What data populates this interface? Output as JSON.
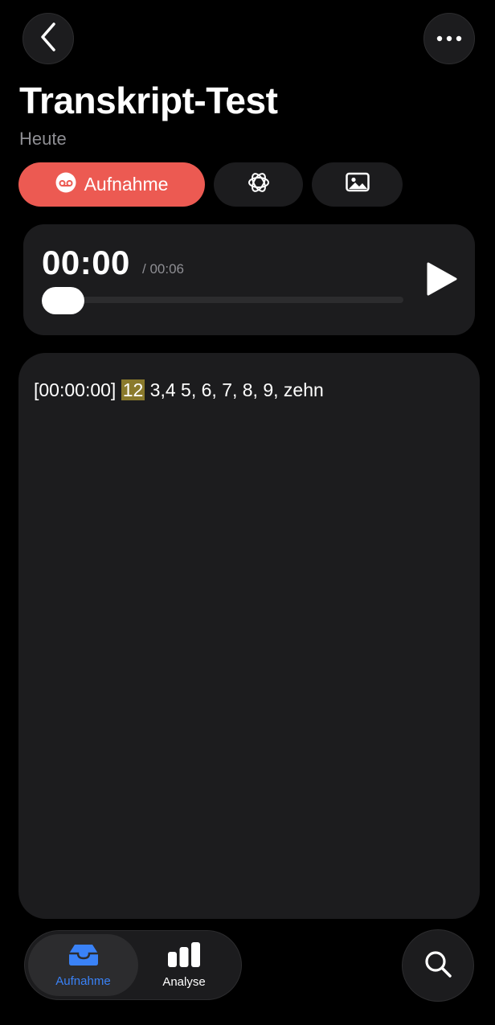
{
  "header": {
    "title": "Transkript-Test",
    "subtitle": "Heute",
    "back_icon": "chevron-left-icon",
    "more_icon": "ellipsis-icon"
  },
  "segments": [
    {
      "id": "recording",
      "label": "Aufnahme",
      "icon": "voicemail-icon",
      "selected": true
    },
    {
      "id": "ai",
      "label": "",
      "icon": "ai-sparkle-icon",
      "selected": false
    },
    {
      "id": "image",
      "label": "",
      "icon": "photo-icon",
      "selected": false
    }
  ],
  "player": {
    "current_time": "00:00",
    "total_time": "/ 00:06",
    "progress": 0,
    "play_icon": "play-icon"
  },
  "transcript": {
    "timestamp": "[00:00:00]",
    "highlighted_word": "12",
    "rest": " 3,4 5, 6, 7, 8, 9, zehn"
  },
  "tabbar": {
    "items": [
      {
        "label": "Aufnahme",
        "icon": "tray-icon",
        "selected": true
      },
      {
        "label": "Analyse",
        "icon": "bar-chart-icon",
        "selected": false
      }
    ]
  },
  "search": {
    "icon": "search-icon"
  },
  "colors": {
    "accent_red": "#ec5a52",
    "accent_blue": "#3a82f7",
    "highlight": "#8a7a2c",
    "card_bg": "#1c1c1e",
    "secondary_text": "#8e8e93"
  }
}
